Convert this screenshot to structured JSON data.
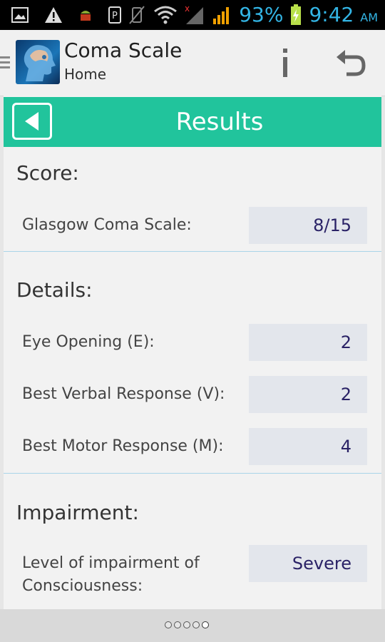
{
  "status_bar": {
    "battery": "93%",
    "time": "9:42",
    "ampm": "AM",
    "icons": [
      "image-icon",
      "warning-icon",
      "android-icon",
      "parking-icon",
      "vibrate-off-icon",
      "wifi-icon",
      "signal-no-service-icon",
      "signal-icon",
      "battery-charging-icon"
    ]
  },
  "action_bar": {
    "title": "Coma Scale",
    "subtitle": "Home",
    "icons": [
      "drawer-icon",
      "app-head-icon",
      "info-icon",
      "undo-icon"
    ]
  },
  "results_bar": {
    "title": "Results",
    "color": "#21c49c"
  },
  "score": {
    "heading": "Score:",
    "label": "Glasgow Coma Scale:",
    "value": "8/15"
  },
  "details": {
    "heading": "Details:",
    "rows": [
      {
        "label": "Eye Opening (E):",
        "value": "2"
      },
      {
        "label": "Best Verbal Response (V):",
        "value": "2"
      },
      {
        "label": "Best Motor Response (M):",
        "value": "4"
      }
    ]
  },
  "impairment": {
    "heading": "Impairment:",
    "label": "Level of impairment of Consciousness:",
    "value": "Severe"
  },
  "pager": {
    "pages": 5,
    "active_page": 5
  }
}
